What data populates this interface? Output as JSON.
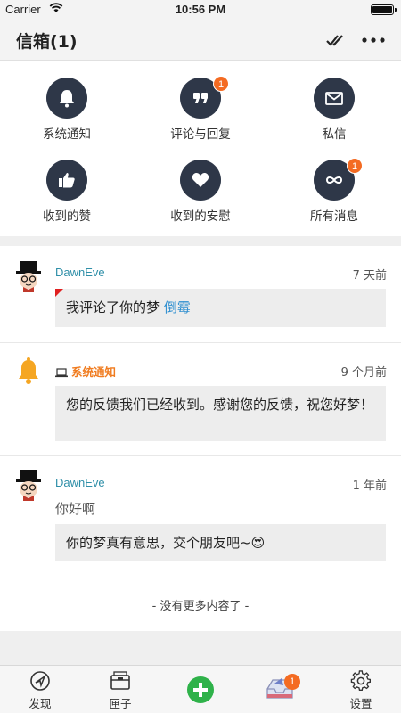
{
  "status_bar": {
    "carrier": "Carrier",
    "time": "10:56 PM",
    "wifi_icon": "wifi-icon",
    "battery_icon": "battery-icon"
  },
  "nav": {
    "title": "信箱(1)",
    "actions": [
      "double-check-icon",
      "more-dots-icon"
    ]
  },
  "grid": {
    "items": [
      {
        "label": "系统通知",
        "icon": "bell-icon",
        "badge": ""
      },
      {
        "label": "评论与回复",
        "icon": "quote-icon",
        "badge": "1"
      },
      {
        "label": "私信",
        "icon": "envelope-icon",
        "badge": ""
      },
      {
        "label": "收到的赞",
        "icon": "thumbs-up-icon",
        "badge": ""
      },
      {
        "label": "收到的安慰",
        "icon": "heart-icon",
        "badge": ""
      },
      {
        "label": "所有消息",
        "icon": "infinity-icon",
        "badge": "1"
      }
    ]
  },
  "feed": {
    "messages": [
      {
        "user": "DawnEve",
        "time": "7 天前",
        "text": "我评论了你的梦",
        "link": "倒霉"
      },
      {
        "user": "系统通知",
        "time": "9 个月前",
        "text": "您的反馈我们已经收到。感谢您的反馈，祝您好梦！"
      },
      {
        "user": "DawnEve",
        "time": "1 年前",
        "quote": "你好啊",
        "text": "你的梦真有意思，交个朋友吧~😍"
      }
    ],
    "end_text": "- 没有更多内容了 -"
  },
  "tab_bar": {
    "tabs": [
      {
        "label": "发现",
        "icon": "compass-icon"
      },
      {
        "label": "匣子",
        "icon": "box-icon"
      },
      {
        "label": "",
        "icon": "plus-icon"
      },
      {
        "label": "",
        "icon": "inbox-icon",
        "badge": "1"
      },
      {
        "label": "设置",
        "icon": "gear-icon"
      }
    ]
  },
  "colors": {
    "accent": "#2e3748",
    "badge": "#f46b22",
    "link": "#2f8fd0",
    "username": "#2f8fa8",
    "system": "#f07c20",
    "add": "#2fb24a"
  }
}
